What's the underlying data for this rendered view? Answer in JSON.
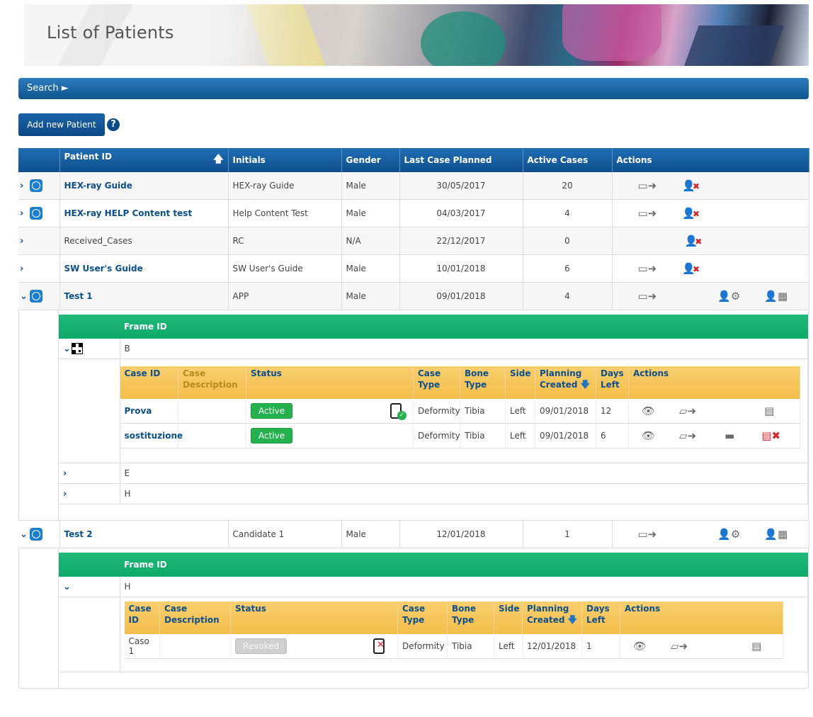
{
  "page": {
    "title": "List of Patients"
  },
  "search": {
    "label": "Search ►"
  },
  "toolbar": {
    "add_patient": "Add new Patient",
    "help": "?"
  },
  "patients_table": {
    "headers": {
      "patient_id": "Patient ID",
      "initials": "Initials",
      "gender": "Gender",
      "last_case": "Last Case Planned",
      "active_cases": "Active Cases",
      "actions": "Actions"
    },
    "sort_icon": "arrow-up-icon",
    "rows": [
      {
        "id": "HEX-ray Guide",
        "initials": "HEX-ray Guide",
        "gender": "Male",
        "last_case": "30/05/2017",
        "active": "20"
      },
      {
        "id": "HEX-ray HELP Content test",
        "initials": "Help Content Test",
        "gender": "Male",
        "last_case": "04/03/2017",
        "active": "4"
      },
      {
        "id": "Received_Cases",
        "initials": "RC",
        "gender": "N/A",
        "last_case": "22/12/2017",
        "active": "0"
      },
      {
        "id": "SW User's Guide",
        "initials": "SW User's Guide",
        "gender": "Male",
        "last_case": "10/01/2018",
        "active": "6"
      },
      {
        "id": "Test 1",
        "initials": "APP",
        "gender": "Male",
        "last_case": "09/01/2018",
        "active": "4"
      },
      {
        "id": "Test 2",
        "initials": "Candidate 1",
        "gender": "Male",
        "last_case": "12/01/2018",
        "active": "1"
      }
    ]
  },
  "frame_header": "Frame ID",
  "case_headers": {
    "case_id": "Case ID",
    "case_desc": "Case Description",
    "status": "Status",
    "case_type": "Case Type",
    "bone_type": "Bone Type",
    "side": "Side",
    "planning": "Planning Created",
    "days_left": "Days Left",
    "actions": "Actions"
  },
  "test1": {
    "frames": [
      "B",
      "E",
      "H"
    ],
    "cases": [
      {
        "id": "Prova",
        "status": "Active",
        "type": "Deformity",
        "bone": "Tibia",
        "side": "Left",
        "planning": "09/01/2018",
        "days": "12"
      },
      {
        "id": "sostituzione",
        "status": "Active",
        "type": "Deformity",
        "bone": "Tibia",
        "side": "Left",
        "planning": "09/01/2018",
        "days": "6"
      }
    ]
  },
  "test2": {
    "frames": [
      "H"
    ],
    "cases": [
      {
        "id": "Caso 1",
        "status": "Revoked",
        "type": "Deformity",
        "bone": "Tibia",
        "side": "Left",
        "planning": "12/01/2018",
        "days": "1"
      }
    ]
  }
}
